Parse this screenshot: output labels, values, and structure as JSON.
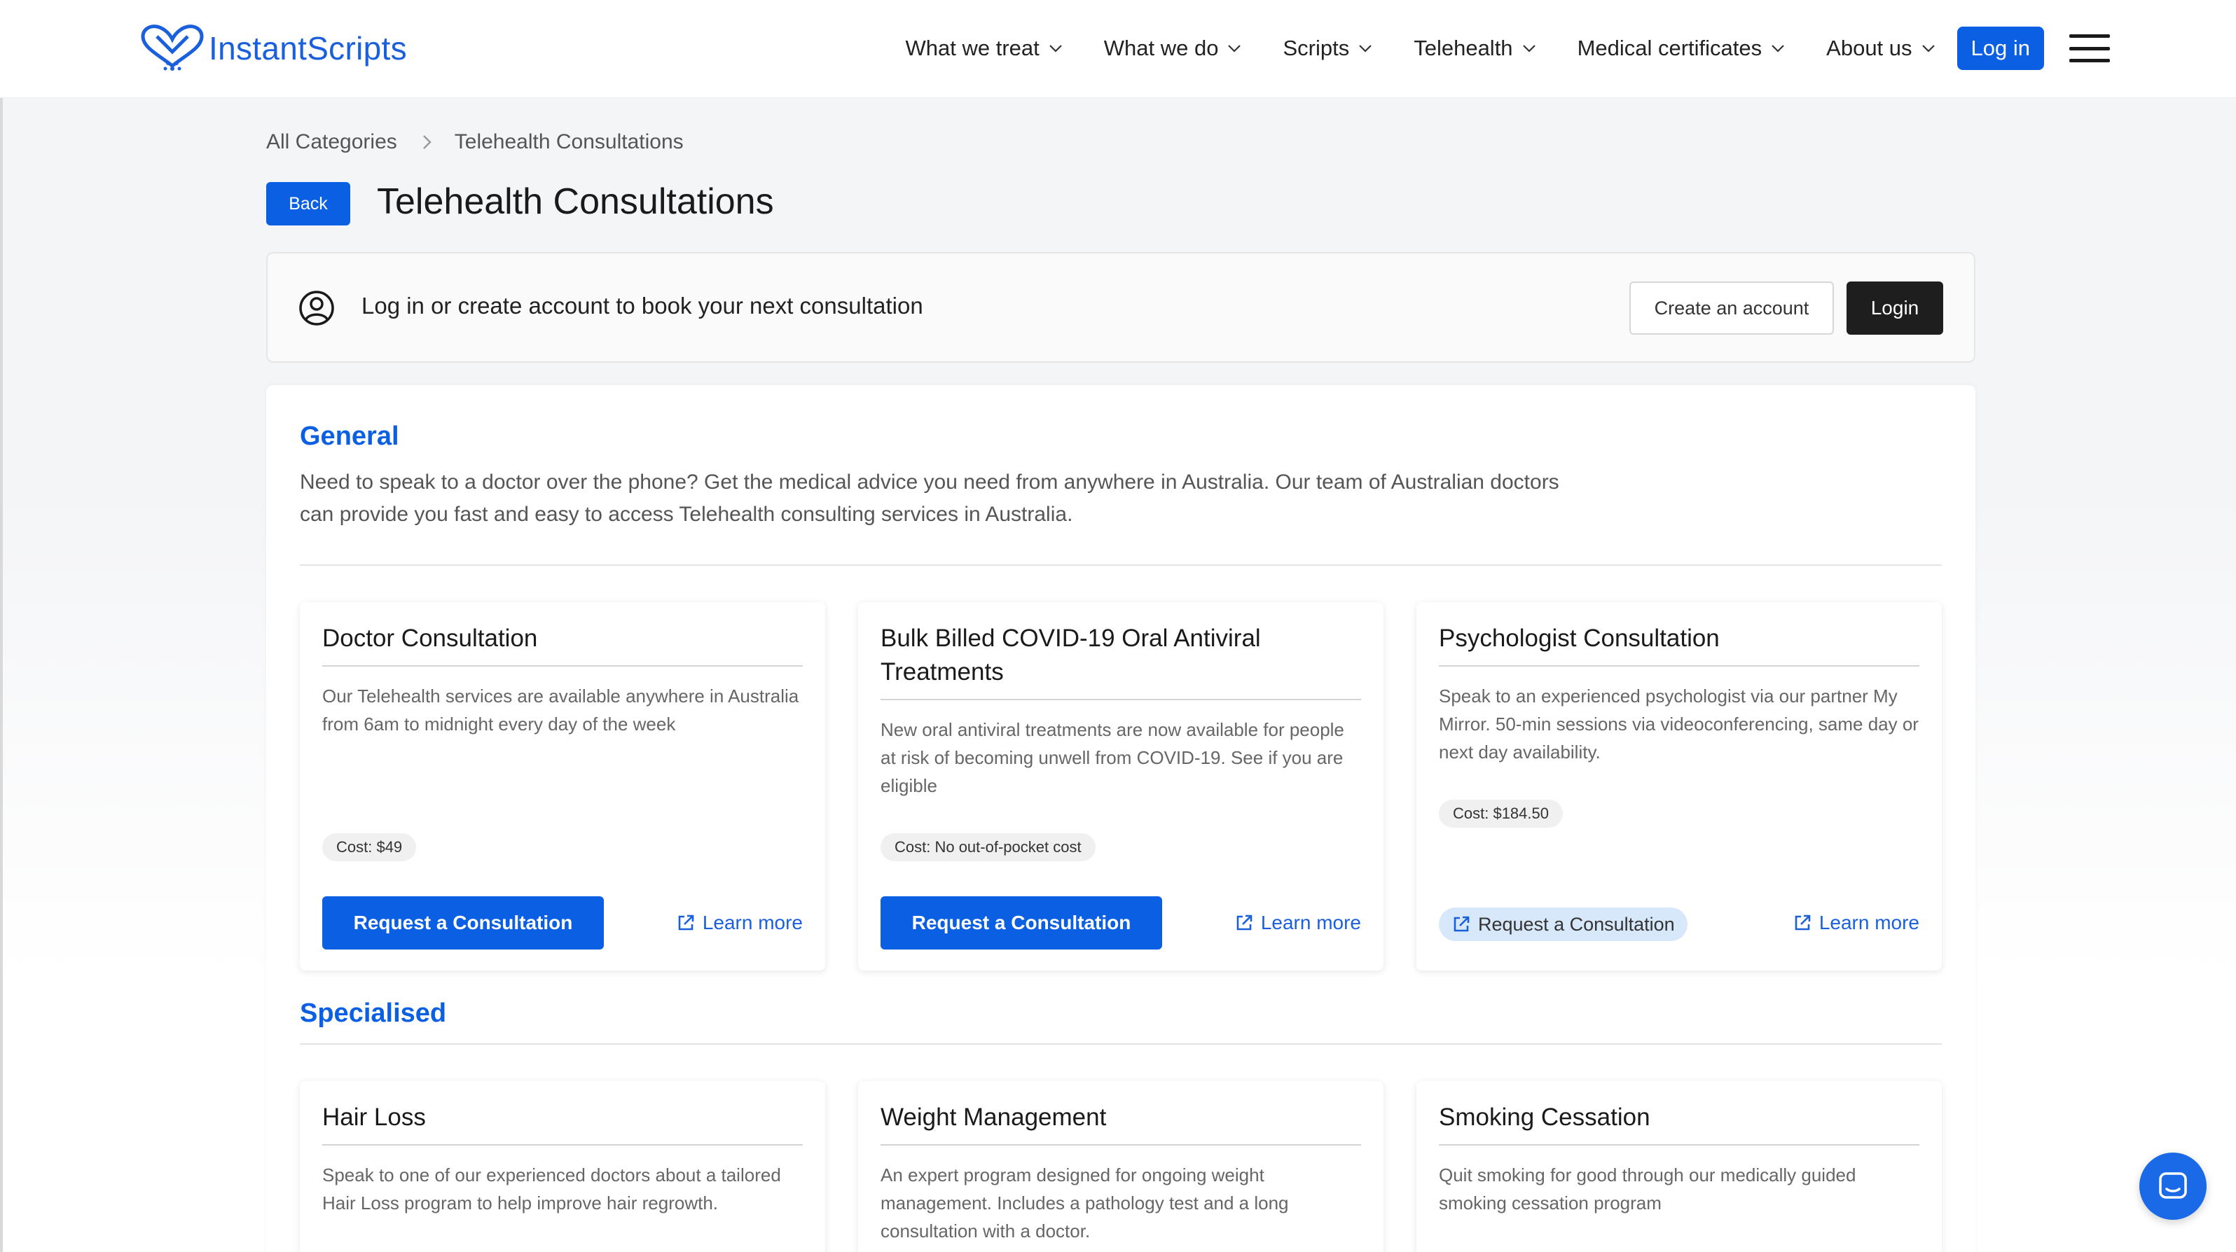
{
  "brand": {
    "name": "InstantScripts",
    "color": "#1a5fdb"
  },
  "nav": {
    "items": [
      {
        "label": "What we treat"
      },
      {
        "label": "What we do"
      },
      {
        "label": "Scripts"
      },
      {
        "label": "Telehealth"
      },
      {
        "label": "Medical certificates"
      },
      {
        "label": "About us"
      }
    ],
    "login_label": "Log in",
    "menu_icon": "hamburger-menu-icon"
  },
  "breadcrumb": {
    "root": "All Categories",
    "current": "Telehealth Consultations"
  },
  "page": {
    "back_label": "Back",
    "title": "Telehealth Consultations"
  },
  "login_banner": {
    "text": "Log in or create account to book your next consultation",
    "create_label": "Create an account",
    "login_label": "Login"
  },
  "general": {
    "title": "General",
    "description": "Need to speak to a doctor over the phone? Get the medical advice you need from anywhere in Australia. Our team of Australian doctors can provide you fast and easy to access Telehealth consulting services in Australia.",
    "cards": [
      {
        "title": "Doctor Consultation",
        "description": "Our Telehealth services are available anywhere in Australia from 6am to midnight every day of the week",
        "cost": "Cost: $49",
        "request_label": "Request a Consultation",
        "learn_more": "Learn more"
      },
      {
        "title": "Bulk Billed COVID-19 Oral Antiviral Treatments",
        "description": "New oral antiviral treatments are now available for people at risk of becoming unwell from COVID-19. See if you are eligible",
        "cost": "Cost: No out-of-pocket cost",
        "request_label": "Request a Consultation",
        "learn_more": "Learn more"
      },
      {
        "title": "Psychologist Consultation",
        "description": "Speak to an experienced psychologist via our partner My Mirror. 50-min sessions via videoconferencing, same day or next day availability.",
        "cost": "Cost: $184.50",
        "request_label": "Request a Consultation",
        "learn_more": "Learn more"
      }
    ]
  },
  "specialised": {
    "title": "Specialised",
    "cards": [
      {
        "title": "Hair Loss",
        "description": "Speak to one of our experienced doctors about a tailored Hair Loss program to help improve hair regrowth."
      },
      {
        "title": "Weight Management",
        "description": "An expert program designed for ongoing weight management. Includes a pathology test and a long consultation with a doctor."
      },
      {
        "title": "Smoking Cessation",
        "description": "Quit smoking for good through our medically guided smoking cessation program"
      }
    ]
  },
  "colors": {
    "primary": "#0b5fe3",
    "dark_button": "#1e1e1e",
    "soft_button": "#d8e8fb"
  }
}
